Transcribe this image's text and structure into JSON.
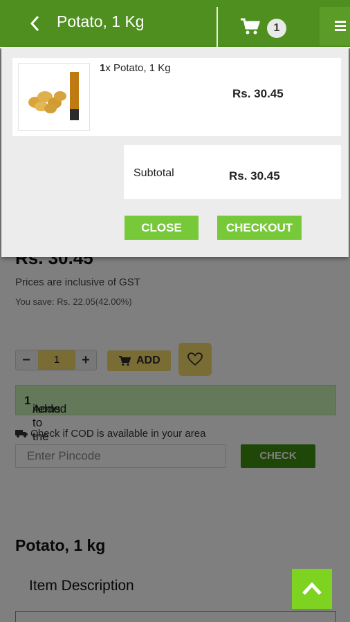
{
  "header": {
    "title": "Potato, 1 Kg",
    "cart_count": "1"
  },
  "product": {
    "price": "Rs. 30.45",
    "gst_note": "Prices are inclusive of GST",
    "savings": "You save: Rs. 22.05(42.00%)",
    "quantity": "1",
    "add_label": "ADD",
    "added_prefix": "Added ",
    "added_count": "1",
    "added_suffix": " items to the cart",
    "cod_text": "Check if COD is available in your area",
    "pincode_placeholder": "Enter Pincode",
    "check_label": "CHECK",
    "name": "Potato, 1 kg",
    "item_description": "Item Description"
  },
  "cart_popup": {
    "item_qty": "1",
    "item_name": "x Potato, 1 Kg",
    "item_price": "Rs. 30.45",
    "subtotal_label": "Subtotal",
    "subtotal_value": "Rs. 30.45",
    "close_label": "CLOSE",
    "checkout_label": "CHECKOUT"
  },
  "colors": {
    "header": "#4e8f1f",
    "button_green": "#78c93a",
    "accent_yellow": "#f2d86b"
  }
}
